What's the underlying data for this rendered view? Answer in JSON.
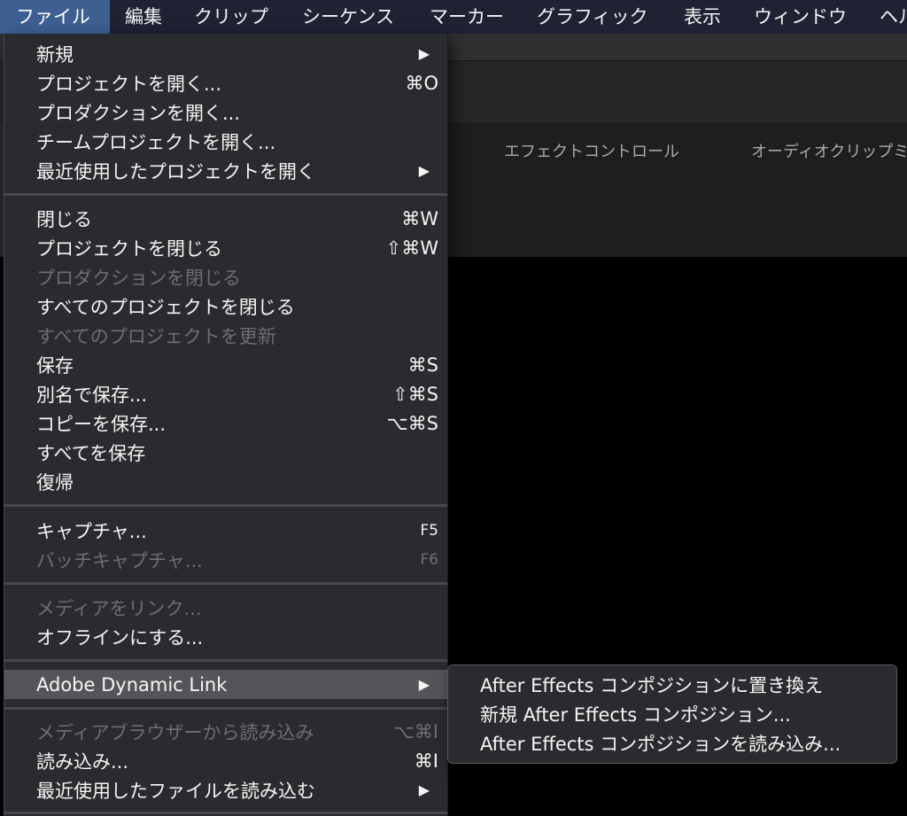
{
  "menubar": {
    "items": [
      {
        "label": "ファイル",
        "active": true
      },
      {
        "label": "編集"
      },
      {
        "label": "クリップ"
      },
      {
        "label": "シーケンス"
      },
      {
        "label": "マーカー"
      },
      {
        "label": "グラフィック"
      },
      {
        "label": "表示"
      },
      {
        "label": "ウィンドウ"
      },
      {
        "label": "ヘル"
      }
    ]
  },
  "background": {
    "tabs": [
      "エフェクトコントロール",
      "オーディオクリップミ"
    ]
  },
  "file_menu": {
    "groups": [
      [
        {
          "label": "新規",
          "submenu": true
        },
        {
          "label": "プロジェクトを開く...",
          "shortcut": "⌘O"
        },
        {
          "label": "プロダクションを開く..."
        },
        {
          "label": "チームプロジェクトを開く..."
        },
        {
          "label": "最近使用したプロジェクトを開く",
          "submenu": true
        }
      ],
      [
        {
          "label": "閉じる",
          "shortcut": "⌘W"
        },
        {
          "label": "プロジェクトを閉じる",
          "shortcut": "⇧⌘W"
        },
        {
          "label": "プロダクションを閉じる",
          "disabled": true
        },
        {
          "label": "すべてのプロジェクトを閉じる"
        },
        {
          "label": "すべてのプロジェクトを更新",
          "disabled": true
        },
        {
          "label": "保存",
          "shortcut": "⌘S"
        },
        {
          "label": "別名で保存...",
          "shortcut": "⇧⌘S"
        },
        {
          "label": "コピーを保存...",
          "shortcut": "⌥⌘S"
        },
        {
          "label": "すべてを保存"
        },
        {
          "label": "復帰"
        }
      ],
      [
        {
          "label": "キャプチャ...",
          "shortcut": "F5"
        },
        {
          "label": "バッチキャプチャ...",
          "shortcut": "F6",
          "disabled": true
        }
      ],
      [
        {
          "label": "メディアをリンク...",
          "disabled": true
        },
        {
          "label": "オフラインにする..."
        }
      ],
      [
        {
          "label": "Adobe Dynamic Link",
          "submenu": true,
          "highlighted": true
        }
      ],
      [
        {
          "label": "メディアブラウザーから読み込み",
          "shortcut": "⌥⌘I",
          "disabled": true
        },
        {
          "label": "読み込み...",
          "shortcut": "⌘I"
        },
        {
          "label": "最近使用したファイルを読み込む",
          "submenu": true
        }
      ]
    ]
  },
  "dynamic_link_submenu": {
    "items": [
      {
        "label": "After Effects コンポジションに置き換え"
      },
      {
        "label": "新規 After Effects コンポジション..."
      },
      {
        "label": "After Effects コンポジションを読み込み..."
      }
    ]
  },
  "colors": {
    "menubar_bg": "#1f2233",
    "menubar_active": "#3e5f91",
    "menu_bg": "#2a2b2e",
    "menu_highlight": "#545558",
    "disabled_text": "#6d6e71"
  }
}
